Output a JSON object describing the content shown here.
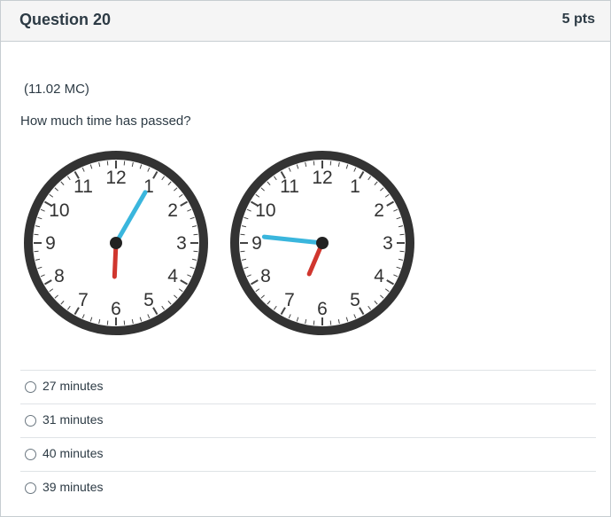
{
  "question": {
    "title": "Question 20",
    "points": "5 pts",
    "code": "(11.02 MC)",
    "prompt": "How much time has passed?"
  },
  "clocks": [
    {
      "time": "6:05",
      "hour_hand_color": "#d0362e",
      "minute_hand_color": "#3ab6dd"
    },
    {
      "time": "6:46",
      "hour_hand_color": "#d0362e",
      "minute_hand_color": "#3ab6dd"
    }
  ],
  "clock_numbers": [
    "12",
    "1",
    "2",
    "3",
    "4",
    "5",
    "6",
    "7",
    "8",
    "9",
    "10",
    "11"
  ],
  "answers": [
    {
      "label": "27 minutes",
      "selected": false
    },
    {
      "label": "31 minutes",
      "selected": false
    },
    {
      "label": "40 minutes",
      "selected": false
    },
    {
      "label": "39 minutes",
      "selected": false
    }
  ],
  "icons": {
    "radio": "radio-button-icon"
  }
}
